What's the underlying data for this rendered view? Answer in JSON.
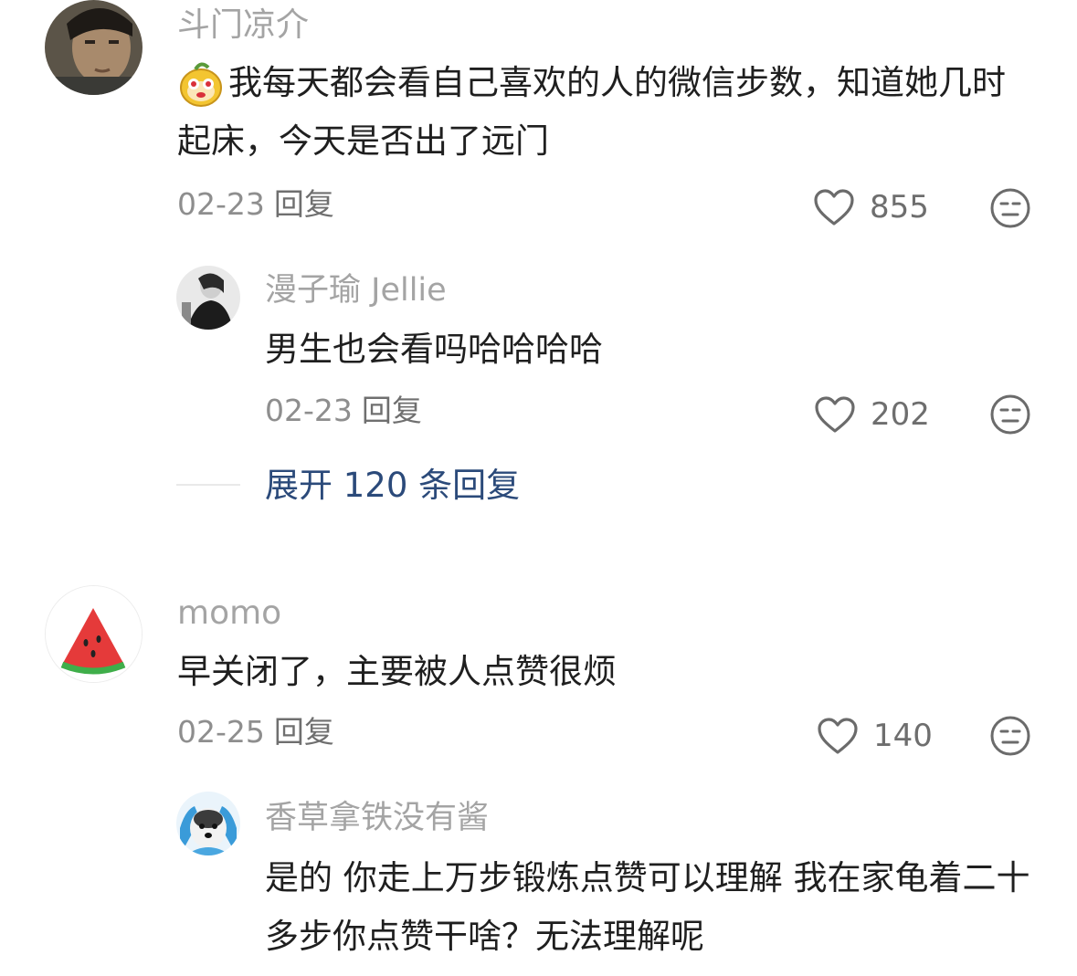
{
  "comments": [
    {
      "user": "斗门凉介",
      "text": "我每天都会看自己喜欢的人的微信步数，知道她几时起床，今天是否出了远门",
      "date": "02-23",
      "reply_label": "回复",
      "likes": "855",
      "has_emoji_prefix": true,
      "replies": [
        {
          "user": "漫子瑜 Jellie",
          "text": "男生也会看吗哈哈哈哈",
          "date": "02-23",
          "reply_label": "回复",
          "likes": "202"
        }
      ],
      "expand_label": "展开 120 条回复"
    },
    {
      "user": "momo",
      "text": "早关闭了，主要被人点赞很烦",
      "date": "02-25",
      "reply_label": "回复",
      "likes": "140",
      "replies": [
        {
          "user": "香草拿铁没有酱",
          "text": "是的 你走上万步锻炼点赞可以理解 我在家龟着二十多步你点赞干啥？无法理解呢"
        }
      ]
    }
  ],
  "colors": {
    "username": "#a4a4a4",
    "content": "#1f1f1f",
    "meta": "#8e8e8e",
    "expand_link": "#2b4a7a"
  },
  "icons": [
    "heart-outline-icon",
    "dislike-face-icon",
    "sticker-emoji-icon"
  ]
}
